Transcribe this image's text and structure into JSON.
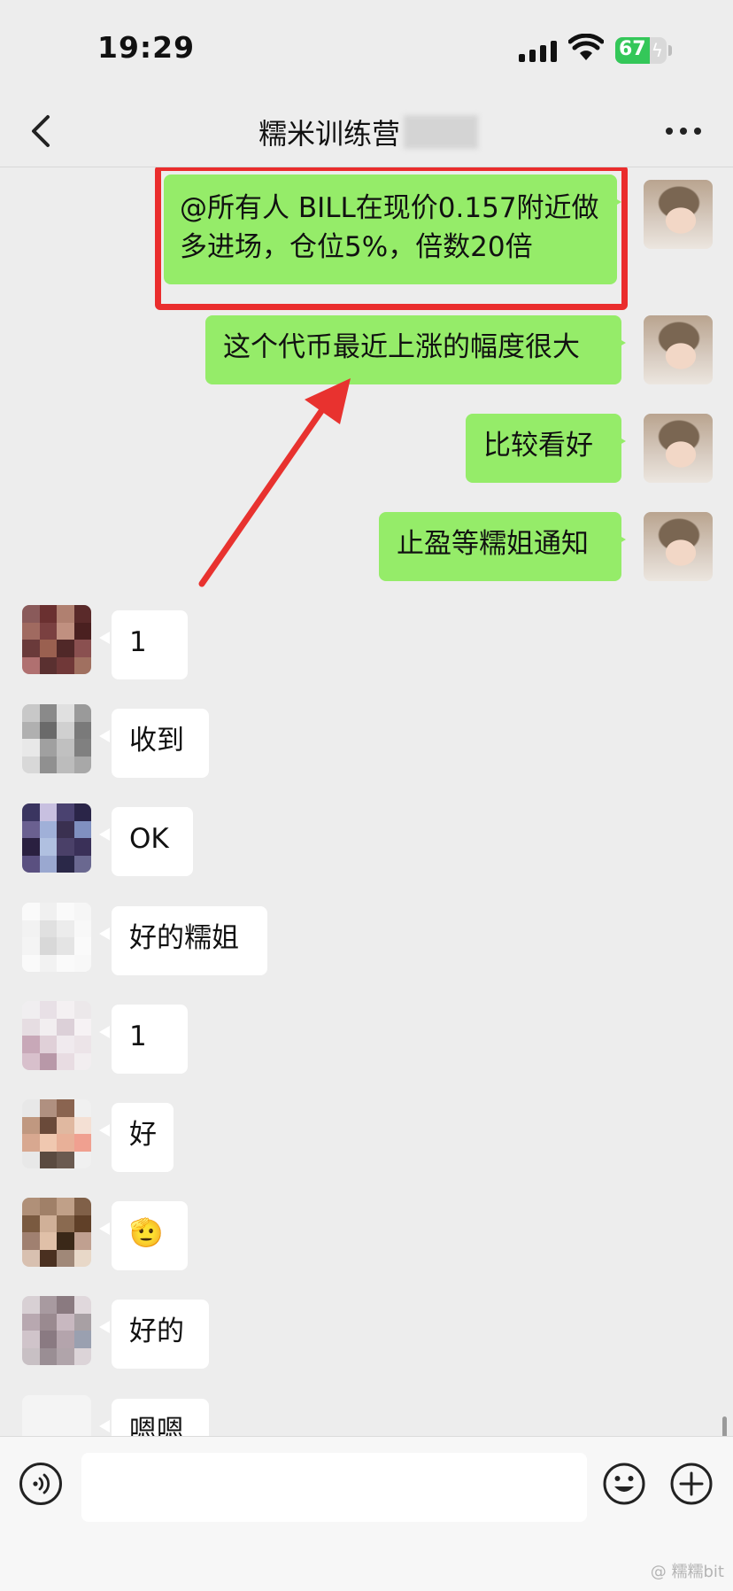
{
  "status_bar": {
    "time": "19:29",
    "battery_level": "67",
    "battery_fraction": 0.67,
    "battery_color": "#34c759"
  },
  "nav": {
    "back_icon": "chevron-left-icon",
    "title": "糯米训练营",
    "more_icon": "more-dots-icon"
  },
  "colors": {
    "my_bubble": "#95ec69",
    "other_bubble": "#ffffff",
    "highlight": "#ea2d2d",
    "chat_bg": "#ededed"
  },
  "messages_mine": [
    "@所有人 BILL在现价0.157附近做",
    "多进场，仓位5%，倍数20倍",
    "这个代币最近上涨的幅度很大",
    "比较看好",
    "止盈等糯姐通知"
  ],
  "messages_others": [
    "1",
    "收到",
    "OK",
    "好的糯姐",
    "1",
    "好",
    "🫡",
    "好的",
    "嗯嗯"
  ],
  "input": {
    "placeholder": "",
    "voice_icon": "voice-icon",
    "emoji_icon": "emoji-icon",
    "plus_icon": "plus-icon"
  },
  "watermark": "@ 糯糯bit"
}
